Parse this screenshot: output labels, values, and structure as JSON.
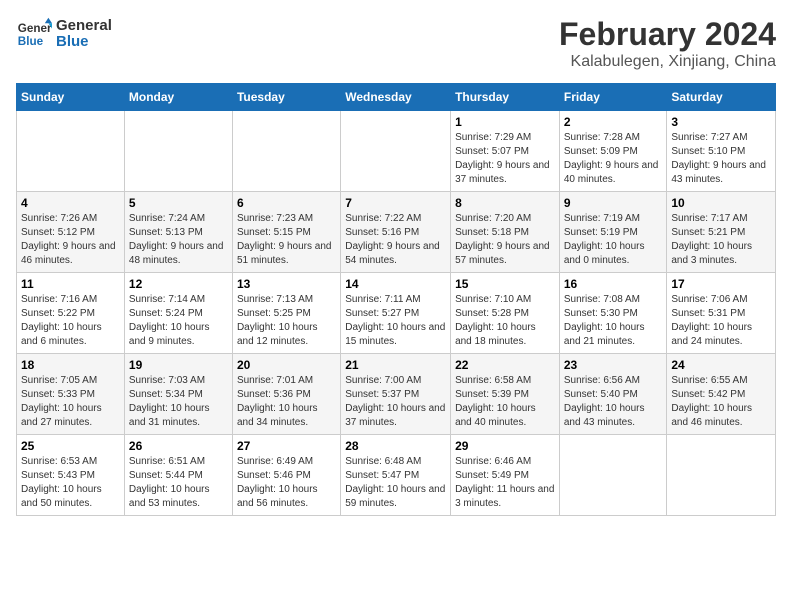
{
  "header": {
    "logo_line1": "General",
    "logo_line2": "Blue",
    "title": "February 2024",
    "subtitle": "Kalabulegen, Xinjiang, China"
  },
  "days_of_week": [
    "Sunday",
    "Monday",
    "Tuesday",
    "Wednesday",
    "Thursday",
    "Friday",
    "Saturday"
  ],
  "weeks": [
    [
      {
        "num": "",
        "info": ""
      },
      {
        "num": "",
        "info": ""
      },
      {
        "num": "",
        "info": ""
      },
      {
        "num": "",
        "info": ""
      },
      {
        "num": "1",
        "info": "Sunrise: 7:29 AM\nSunset: 5:07 PM\nDaylight: 9 hours and 37 minutes."
      },
      {
        "num": "2",
        "info": "Sunrise: 7:28 AM\nSunset: 5:09 PM\nDaylight: 9 hours and 40 minutes."
      },
      {
        "num": "3",
        "info": "Sunrise: 7:27 AM\nSunset: 5:10 PM\nDaylight: 9 hours and 43 minutes."
      }
    ],
    [
      {
        "num": "4",
        "info": "Sunrise: 7:26 AM\nSunset: 5:12 PM\nDaylight: 9 hours and 46 minutes."
      },
      {
        "num": "5",
        "info": "Sunrise: 7:24 AM\nSunset: 5:13 PM\nDaylight: 9 hours and 48 minutes."
      },
      {
        "num": "6",
        "info": "Sunrise: 7:23 AM\nSunset: 5:15 PM\nDaylight: 9 hours and 51 minutes."
      },
      {
        "num": "7",
        "info": "Sunrise: 7:22 AM\nSunset: 5:16 PM\nDaylight: 9 hours and 54 minutes."
      },
      {
        "num": "8",
        "info": "Sunrise: 7:20 AM\nSunset: 5:18 PM\nDaylight: 9 hours and 57 minutes."
      },
      {
        "num": "9",
        "info": "Sunrise: 7:19 AM\nSunset: 5:19 PM\nDaylight: 10 hours and 0 minutes."
      },
      {
        "num": "10",
        "info": "Sunrise: 7:17 AM\nSunset: 5:21 PM\nDaylight: 10 hours and 3 minutes."
      }
    ],
    [
      {
        "num": "11",
        "info": "Sunrise: 7:16 AM\nSunset: 5:22 PM\nDaylight: 10 hours and 6 minutes."
      },
      {
        "num": "12",
        "info": "Sunrise: 7:14 AM\nSunset: 5:24 PM\nDaylight: 10 hours and 9 minutes."
      },
      {
        "num": "13",
        "info": "Sunrise: 7:13 AM\nSunset: 5:25 PM\nDaylight: 10 hours and 12 minutes."
      },
      {
        "num": "14",
        "info": "Sunrise: 7:11 AM\nSunset: 5:27 PM\nDaylight: 10 hours and 15 minutes."
      },
      {
        "num": "15",
        "info": "Sunrise: 7:10 AM\nSunset: 5:28 PM\nDaylight: 10 hours and 18 minutes."
      },
      {
        "num": "16",
        "info": "Sunrise: 7:08 AM\nSunset: 5:30 PM\nDaylight: 10 hours and 21 minutes."
      },
      {
        "num": "17",
        "info": "Sunrise: 7:06 AM\nSunset: 5:31 PM\nDaylight: 10 hours and 24 minutes."
      }
    ],
    [
      {
        "num": "18",
        "info": "Sunrise: 7:05 AM\nSunset: 5:33 PM\nDaylight: 10 hours and 27 minutes."
      },
      {
        "num": "19",
        "info": "Sunrise: 7:03 AM\nSunset: 5:34 PM\nDaylight: 10 hours and 31 minutes."
      },
      {
        "num": "20",
        "info": "Sunrise: 7:01 AM\nSunset: 5:36 PM\nDaylight: 10 hours and 34 minutes."
      },
      {
        "num": "21",
        "info": "Sunrise: 7:00 AM\nSunset: 5:37 PM\nDaylight: 10 hours and 37 minutes."
      },
      {
        "num": "22",
        "info": "Sunrise: 6:58 AM\nSunset: 5:39 PM\nDaylight: 10 hours and 40 minutes."
      },
      {
        "num": "23",
        "info": "Sunrise: 6:56 AM\nSunset: 5:40 PM\nDaylight: 10 hours and 43 minutes."
      },
      {
        "num": "24",
        "info": "Sunrise: 6:55 AM\nSunset: 5:42 PM\nDaylight: 10 hours and 46 minutes."
      }
    ],
    [
      {
        "num": "25",
        "info": "Sunrise: 6:53 AM\nSunset: 5:43 PM\nDaylight: 10 hours and 50 minutes."
      },
      {
        "num": "26",
        "info": "Sunrise: 6:51 AM\nSunset: 5:44 PM\nDaylight: 10 hours and 53 minutes."
      },
      {
        "num": "27",
        "info": "Sunrise: 6:49 AM\nSunset: 5:46 PM\nDaylight: 10 hours and 56 minutes."
      },
      {
        "num": "28",
        "info": "Sunrise: 6:48 AM\nSunset: 5:47 PM\nDaylight: 10 hours and 59 minutes."
      },
      {
        "num": "29",
        "info": "Sunrise: 6:46 AM\nSunset: 5:49 PM\nDaylight: 11 hours and 3 minutes."
      },
      {
        "num": "",
        "info": ""
      },
      {
        "num": "",
        "info": ""
      }
    ]
  ]
}
